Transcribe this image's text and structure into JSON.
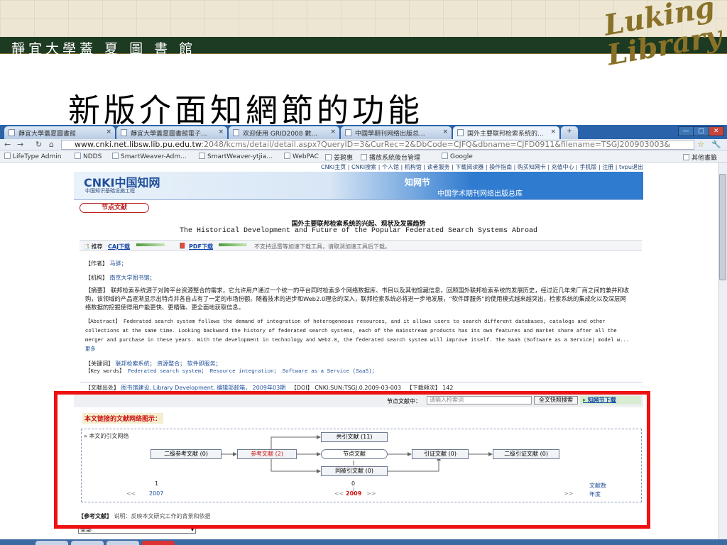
{
  "header": {
    "logo_text": "靜宜大學蓋 夏 圖 書 館",
    "seal_text_1": "Luking",
    "seal_text_2": "Library",
    "slide_title": "新版介面知網節的功能"
  },
  "browser": {
    "tabs": [
      {
        "label": "靜宜大學蓋夏圖書館"
      },
      {
        "label": "靜宜大學蓋夏圖書館電子..."
      },
      {
        "label": "欢迎使用 GRID2008 數..."
      },
      {
        "label": "中國學期刊网络出版总..."
      },
      {
        "label": "国外主要联邦检索系统的..."
      }
    ],
    "close_glyph": "×",
    "new_tab_glyph": "+",
    "window_buttons": [
      "—",
      "□",
      "✕"
    ],
    "url_host": "www.cnki.net.libsw.lib.pu.edu.tw",
    "url_rest": ":2048/kcms/detail/detail.aspx?QueryID=3&CurRec=2&DbCode=CJFQ&dbname=CJFD0911&filename=TSGJ200903003&",
    "nav_icons": [
      "back-icon",
      "forward-icon",
      "reload-icon",
      "home-icon"
    ],
    "bookmarks": [
      "LifeType Admin",
      "NDDS",
      "SmartWeaver-Adm...",
      "SmartWeaver-ytjia...",
      "WebPAC",
      "姜碧惠",
      "播放系統後台管理",
      "Google"
    ],
    "other_bookmarks": "其他書籤"
  },
  "cnki": {
    "topnav": "CNKI主页 | CNKI搜索 | 个人馆 | 机构馆 | 读者服务 | 下载阅读器 | 操作指南 | 购买知网卡 | 充值中心 | 手机版 | 注册 | tvpu退出",
    "logo": "CNKI中国知网",
    "logo_sub": "中国知识基础设施工程",
    "zhiwangjie": "知网节",
    "header_title": "中国学术期刊网络出版总库",
    "node_pill": "节点文献",
    "title_cn": "国外主要联邦检索系统的兴起、现状及发展趋势",
    "title_en": "The Historical Development and Future of the Popular Federated Search Systems Abroad",
    "download": {
      "recommend": "推荐",
      "caj": "CAJ下载",
      "pdf": "PDF下载",
      "note": "不支持迅雷等加速下载工具，请取消加速工具后下载。"
    },
    "author_label": "【作者】",
    "author": "马骅；",
    "org_label": "【机构】",
    "org": "南京大学图书馆；",
    "abstract_label": "【摘要】",
    "abstract": "联邦检索系统源于对跨平台资源整合的需求，它允许用户通过一个统一的平台同时检索多个网络数据库、书目以及其他馆藏信息。回顾国外联邦检索系统的发展历史，经过近几年来厂商之间的兼并和收购，该领域的产品逐渐显示出特点并各自占有了一定的市场份额。随着技术的进步和Web2.0理念的深入，联邦检索系统必将进一步地发展，“软件即服务”的使用模式越来越突出，检索系统的集成化以及深层网络数据的挖掘使得用户能更快、更精确、更全面地获取信息。",
    "abstract_en_label": "【Abstract】",
    "abstract_en": "Federated search system follows the demand of integration of heterogeneous resources, and it allows users to search different databases, catalogs and other collections at the same time. Looking backward the history of federated search systems, each of the mainstream products has its own features and market share after all the merger and purchase in these years. With the development in technology and Web2.0, the federated search system will improve itself. The SaaS (Software as a Service) model w...",
    "more": "更多",
    "keywords_label": "【关键词】",
    "keywords": [
      "联邦检索系统；",
      "资源整合；",
      "软件即服务；"
    ],
    "keywords_en_label": "【Key words】",
    "keywords_en": [
      "Federated search system；",
      "Resource integration；",
      "Software as a Service (SaaS)；"
    ],
    "source_label": "【文献出处】",
    "source": "图书馆建设,",
    "source_en": "Library Development,",
    "editor": "编辑部邮箱，",
    "issue": "2009年03期",
    "doi_label": "【DOI】",
    "doi": "CNKI:SUN:TSGJ.0.2009-03-003",
    "downloads_label": "【下载频次】",
    "downloads": "142",
    "search_label": "节点文献中：",
    "search_placeholder": "请输入检索词",
    "search_button": "全文快照搜索",
    "search_link": "知网节下载",
    "network_title": "本文链接的文献网络图示：",
    "network_label": "本文的引文网络",
    "nodes": {
      "secondary_ref": "二级参考文献 (0)",
      "ref": "参考文献 (2)",
      "center": "节点文献",
      "co_cite": "共引文献 (11)",
      "co_cited": "同被引文献 (0)",
      "citing": "引证文献 (0)",
      "secondary_citing": "二级引证文献 (0)"
    },
    "timeline": {
      "left_count": "1",
      "left_year": "2007",
      "mid_count": "0",
      "mid_year": "2009",
      "right_label1": "文献数",
      "right_label2": "年度",
      "nav_glyph": "<<",
      "nav_glyph2": ">>"
    },
    "ref_title": "【参考文献】",
    "ref_desc": "说明：反映本文研究工作的背景和依据",
    "select_value": "全部"
  }
}
